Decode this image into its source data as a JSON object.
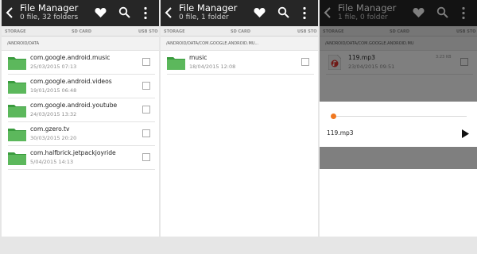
{
  "colors": {
    "actionbar": "#262626",
    "folder": "#4caf50",
    "accent": "#f07820"
  },
  "screens": [
    {
      "title": "File Manager",
      "subtitle": "0 file, 32 folders",
      "tabs": [
        "STORAGE",
        "SD CARD",
        "USB STO"
      ],
      "path": "/ANDROID/DATA",
      "items": [
        {
          "name": "com.google.android.music",
          "date": "25/03/2015 07:13"
        },
        {
          "name": "com.google.android.videos",
          "date": "19/01/2015 06:48"
        },
        {
          "name": "com.google.android.youtube",
          "date": "24/03/2015 13:32"
        },
        {
          "name": "com.gzero.tv",
          "date": "30/03/2015 20:20"
        },
        {
          "name": "com.halfbrick.jetpackjoyride",
          "date": "5/04/2015 14:13"
        }
      ]
    },
    {
      "title": "File Manager",
      "subtitle": "0 file, 1 folder",
      "tabs": [
        "STORAGE",
        "SD CARD",
        "USB STO"
      ],
      "path": "/ANDROID/DATA/COM.GOOGLE.ANDROID.MU...",
      "items": [
        {
          "name": "music",
          "date": "18/04/2015 12:08"
        }
      ]
    },
    {
      "title": "File Manager",
      "subtitle": "1 file, 0 folder",
      "tabs": [
        "STORAGE",
        "SD CARD",
        "USB STO"
      ],
      "path": "/ANDROID/DATA/COM.GOOGLE.ANDROID.MU",
      "items": [
        {
          "name": "119.mp3",
          "date": "23/04/2015 09:51",
          "time": "3:23 KB"
        }
      ],
      "player": {
        "track": "119.mp3",
        "progress": 0.0
      }
    }
  ],
  "icons": [
    "back-arrow-icon",
    "heart-icon",
    "search-icon",
    "more-vert-icon",
    "folder-icon",
    "audio-file-icon",
    "play-icon"
  ]
}
